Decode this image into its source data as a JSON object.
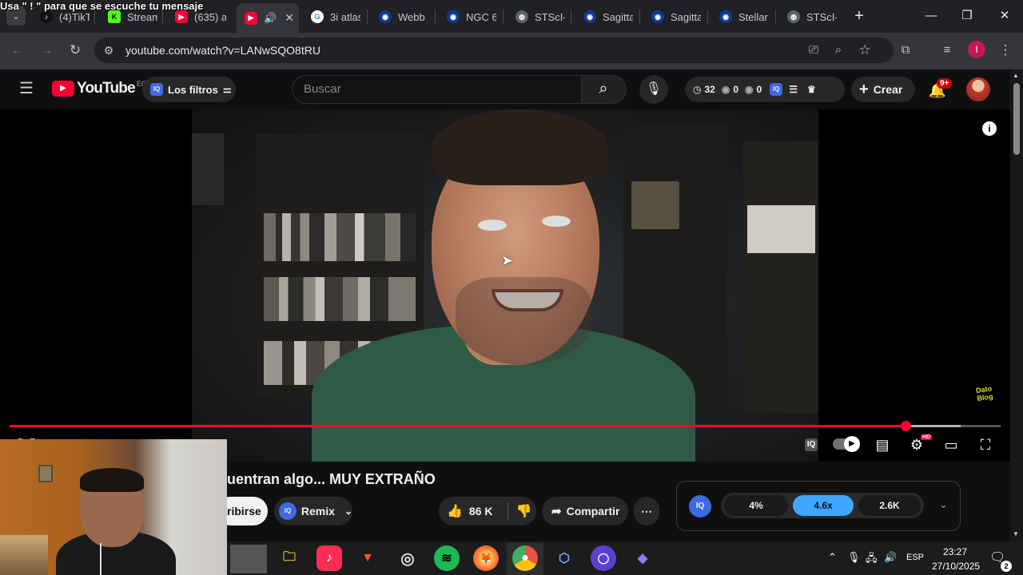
{
  "overlay_message": "Usa \" ! \" para que se escuche tu mensaje",
  "tabs": [
    {
      "title": "(4)TikTo",
      "icon": "tiktok-icon"
    },
    {
      "title": "Stream",
      "icon": "kick-icon"
    },
    {
      "title": "(635) a",
      "icon": "youtube-icon"
    },
    {
      "title": "",
      "icon": "youtube-icon",
      "active": true
    },
    {
      "title": "3i atlas",
      "icon": "google-icon"
    },
    {
      "title": "Webb",
      "icon": "nasa-icon"
    },
    {
      "title": "NGC 6",
      "icon": "nasa-icon"
    },
    {
      "title": "STScI-0",
      "icon": "globe-icon"
    },
    {
      "title": "Sagitta",
      "icon": "nasa-icon"
    },
    {
      "title": "Sagitta",
      "icon": "nasa-icon"
    },
    {
      "title": "Stellar",
      "icon": "nasa-icon"
    },
    {
      "title": "STScI-0",
      "icon": "globe-icon"
    }
  ],
  "address_bar": {
    "url": "youtube.com/watch?v=LANwSQO8tRU"
  },
  "youtube": {
    "logo_text": "YouTube",
    "country_code": "EC",
    "filters_label": "Los filtros",
    "search_placeholder": "Buscar",
    "stats": {
      "views": "32",
      "eye1": "0",
      "eye2": "0"
    },
    "create_label": "Crear",
    "notification_badge": "9+"
  },
  "video": {
    "progress_fraction": 0.904,
    "buffered_fraction": 0.96,
    "settings_badge": "HD"
  },
  "below_video": {
    "title": "uentran algo... MUY EXTRAÑO",
    "subscribe_label": "ribirse",
    "remix_label": "Remix",
    "like_count": "86 K",
    "share_label": "Compartir"
  },
  "iq_panel": {
    "stat1": "4%",
    "stat2": "4.6x",
    "stat3": "2.6K"
  },
  "taskbar": {
    "language": "ESP",
    "time": "23:27",
    "date": "27/10/2025",
    "notification_count": "2"
  },
  "colors": {
    "youtube_red": "#ff0033",
    "iq_blue": "#3ea6ff",
    "background": "#0f0f0f"
  }
}
